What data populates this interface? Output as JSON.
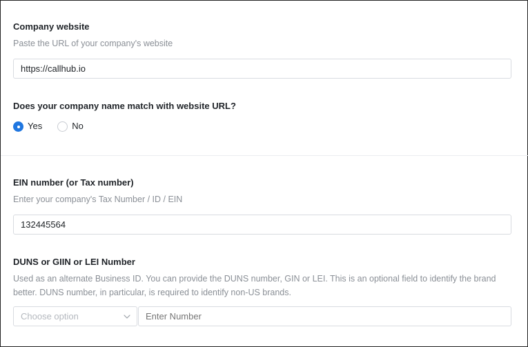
{
  "website": {
    "label": "Company website",
    "help": "Paste the URL of your company's website",
    "value": "https://callhub.io"
  },
  "name_match": {
    "label": "Does your company name match with website URL?",
    "options": [
      "Yes",
      "No"
    ],
    "selected": "Yes"
  },
  "ein": {
    "label": "EIN number (or Tax number)",
    "help": "Enter your company's Tax Number / ID / EIN",
    "value": "132445564"
  },
  "duns": {
    "label": "DUNS or GIIN or LEI Number",
    "help": "Used as an alternate Business ID. You can provide the DUNS number, GIN or LEI. This is an optional field to identify the brand better. DUNS number, in particular, is required to identify non-US brands.",
    "select_placeholder": "Choose option",
    "number_placeholder": "Enter Number"
  },
  "colors": {
    "accent": "#1f76e0",
    "border": "#d8dbe0",
    "muted_text": "#8a8f96"
  }
}
